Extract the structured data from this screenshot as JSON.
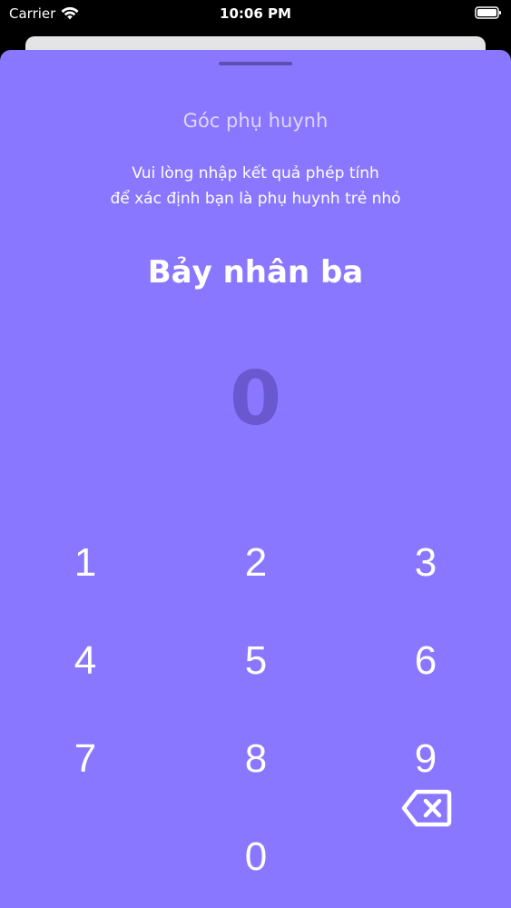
{
  "status_bar": {
    "carrier": "Carrier",
    "time": "10:06 PM",
    "wifi_icon": "wifi-icon",
    "battery_icon": "battery-icon"
  },
  "parent_gate": {
    "title": "Góc phụ huynh",
    "instruction_line1": "Vui lòng nhập kết quả phép tính",
    "instruction_line2": "để xác định bạn là phụ huynh trẻ nhỏ",
    "question": "Bảy nhân ba",
    "answer": "0"
  },
  "keypad": {
    "keys": [
      "1",
      "2",
      "3",
      "4",
      "5",
      "6",
      "7",
      "8",
      "9",
      "0"
    ],
    "backspace_icon": "backspace-icon"
  },
  "colors": {
    "sheet_background": "#8a77ff",
    "answer_text": "#6a58cf",
    "title_text": "#ddd6ff",
    "grabber": "#5d4fb0"
  }
}
